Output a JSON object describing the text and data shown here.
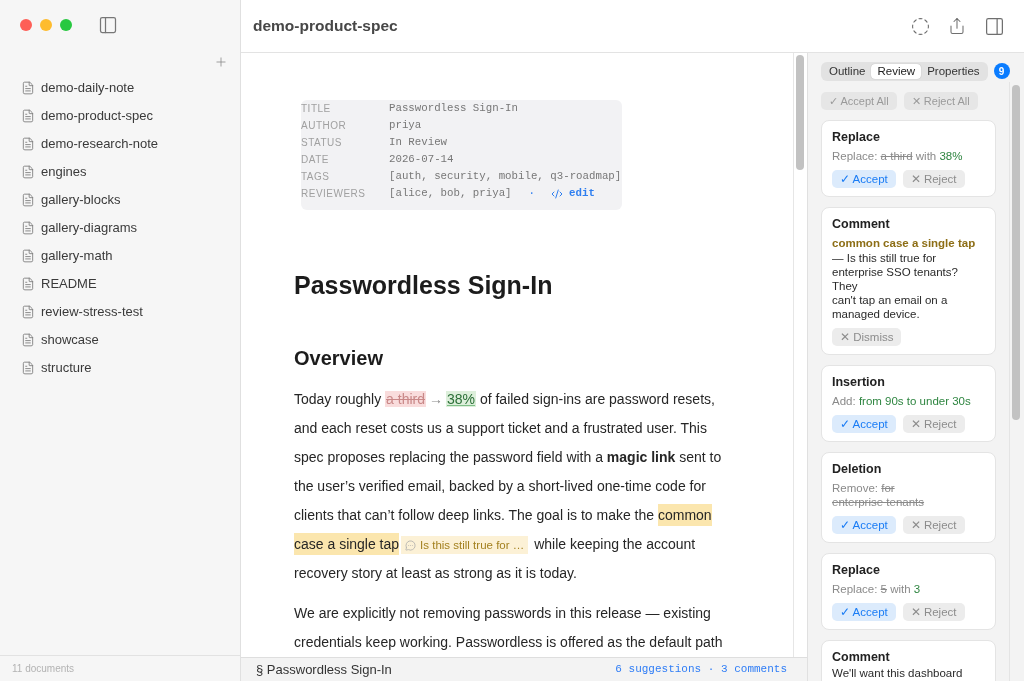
{
  "sidebar": {
    "documents": [
      "demo-daily-note",
      "demo-product-spec",
      "demo-research-note",
      "engines",
      "gallery-blocks",
      "gallery-diagrams",
      "gallery-math",
      "README",
      "review-stress-test",
      "showcase",
      "structure"
    ],
    "footer": "11 documents"
  },
  "header": {
    "title": "demo-product-spec"
  },
  "frontmatter": {
    "rows": [
      {
        "key": "TITLE",
        "value": "Passwordless Sign-In"
      },
      {
        "key": "AUTHOR",
        "value": "priya"
      },
      {
        "key": "STATUS",
        "value": "In Review"
      },
      {
        "key": "DATE",
        "value": "2026-07-14"
      },
      {
        "key": "TAGS",
        "value": "[auth, security, mobile, q3-roadmap]"
      },
      {
        "key": "REVIEWERS",
        "value": "[alice, bob, priya]",
        "separator": "·",
        "edit_link": "edit"
      }
    ]
  },
  "document": {
    "title": "Passwordless Sign-In",
    "sections": [
      {
        "heading": "Overview",
        "paragraphs": [
          {
            "segments": [
              {
                "kind": "text",
                "text": "Today roughly "
              },
              {
                "kind": "deleted",
                "text": "a third"
              },
              {
                "kind": "arrow",
                "text": "→"
              },
              {
                "kind": "inserted",
                "text": "38%"
              },
              {
                "kind": "text",
                "text": " of failed sign-ins are password resets, and each reset costs us a support ticket and a frustrated user. This spec proposes replacing the password field with a **magic link** sent to the user’s verified email, backed by a short-lived one-time code for clients that can’t follow deep links. The goal is to make the "
              },
              {
                "kind": "highlight",
                "text": "common case a single tap"
              },
              {
                "kind": "comment",
                "text": "Is this still true for …"
              },
              {
                "kind": "text",
                "text": " while keeping the account recovery story at least as strong as it is today."
              }
            ]
          },
          {
            "segments": [
              {
                "kind": "text",
                "text": "We are explicitly not removing passwords in this release — existing credentials keep working. Passwordless is offered as the default path"
              }
            ]
          }
        ]
      }
    ]
  },
  "status_bar": {
    "section": "§ Passwordless Sign-In",
    "summary": "6 suggestions · 3 comments"
  },
  "review_panel": {
    "tabs": [
      {
        "label": "Outline",
        "selected": false
      },
      {
        "label": "Review",
        "selected": true
      },
      {
        "label": "Properties",
        "selected": false
      }
    ],
    "badge": "9",
    "bulk_actions": [
      "✓ Accept All",
      "✕ Reject All"
    ],
    "cards": [
      {
        "kind": "suggestion",
        "title": "Replace",
        "summary": [
          {
            "kind": "label",
            "text": "Replace:"
          },
          {
            "kind": "deleted",
            "text": "a third"
          },
          {
            "kind": "plain",
            "text": "with"
          },
          {
            "kind": "inserted",
            "text": "38%"
          }
        ],
        "actions": [
          {
            "kind": "accept",
            "label": "✓ Accept"
          },
          {
            "kind": "reject",
            "label": "✕ Reject"
          }
        ]
      },
      {
        "kind": "comment",
        "title": "Comment",
        "quote": "common case a single tap",
        "body": "— Is this still true for enterprise SSO tenants? They\ncan't tap an email on a managed device.",
        "actions": [
          {
            "kind": "dismiss",
            "label": "✕ Dismiss"
          }
        ]
      },
      {
        "kind": "suggestion",
        "title": "Insertion",
        "summary": [
          {
            "kind": "label",
            "text": "Add:"
          },
          {
            "kind": "inserted",
            "text": "from 90s to under 30s"
          }
        ],
        "actions": [
          {
            "kind": "accept",
            "label": "✓ Accept"
          },
          {
            "kind": "reject",
            "label": "✕ Reject"
          }
        ]
      },
      {
        "kind": "suggestion",
        "title": "Deletion",
        "summary": [
          {
            "kind": "label",
            "text": "Remove:"
          },
          {
            "kind": "deleted",
            "text": "for\nenterprise tenants"
          }
        ],
        "actions": [
          {
            "kind": "accept",
            "label": "✓ Accept"
          },
          {
            "kind": "reject",
            "label": "✕ Reject"
          }
        ]
      },
      {
        "kind": "suggestion",
        "title": "Replace",
        "summary": [
          {
            "kind": "label",
            "text": "Replace:"
          },
          {
            "kind": "deleted",
            "text": "5"
          },
          {
            "kind": "plain",
            "text": "with"
          },
          {
            "kind": "inserted",
            "text": "3"
          }
        ],
        "actions": [
          {
            "kind": "accept",
            "label": "✓ Accept"
          },
          {
            "kind": "reject",
            "label": "✕ Reject"
          }
        ]
      },
      {
        "kind": "comment",
        "title": "Comment",
        "body": "We'll want this dashboard"
      }
    ]
  }
}
